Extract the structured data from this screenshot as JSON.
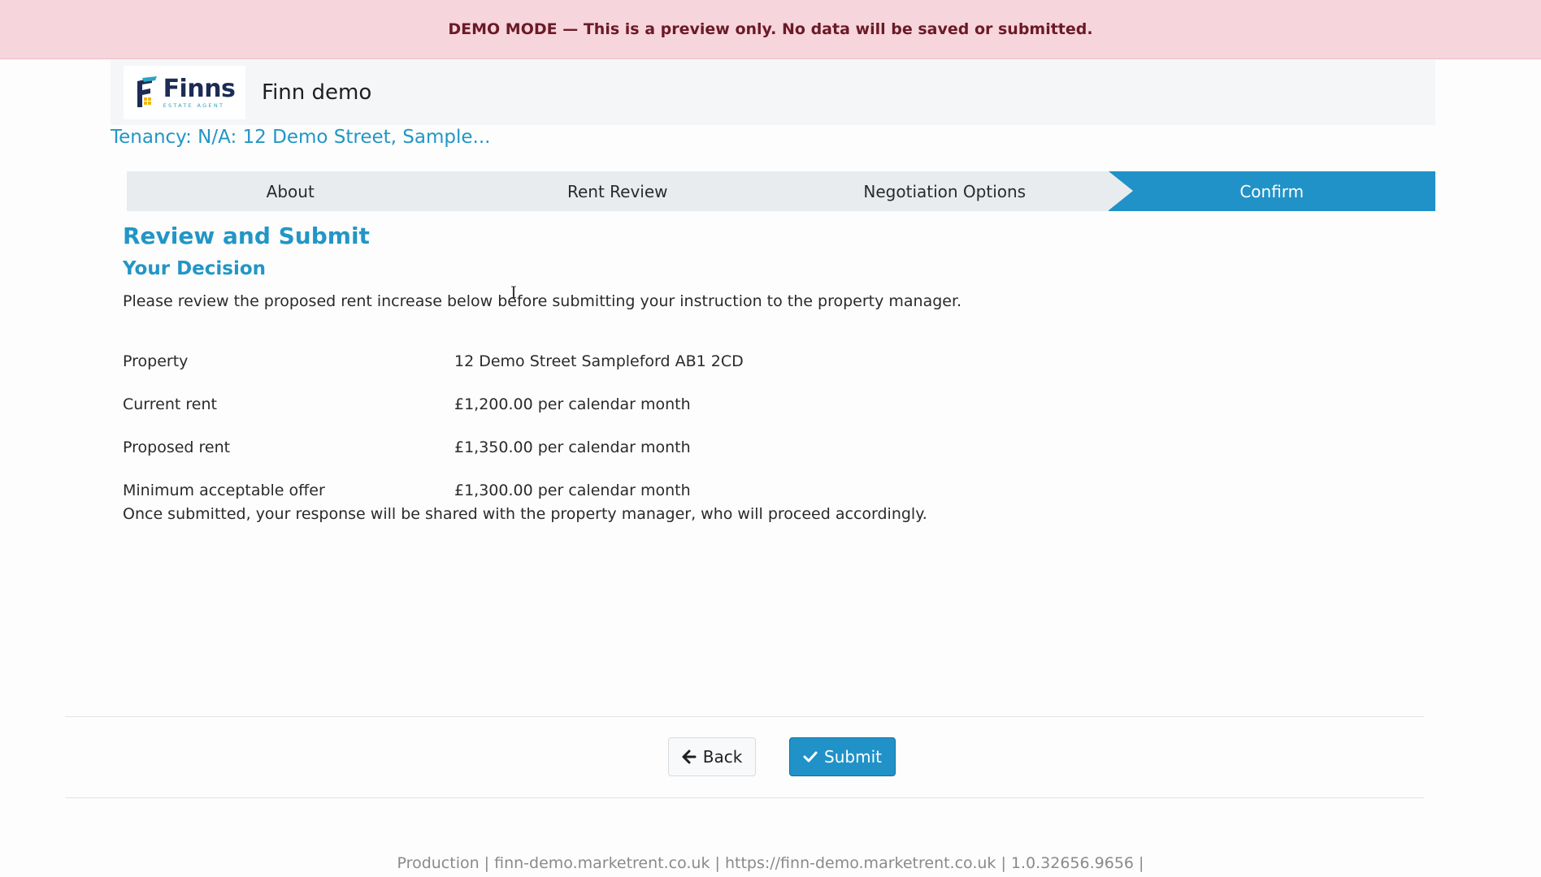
{
  "banner": {
    "text": "DEMO MODE — This is a preview only. No data will be saved or submitted."
  },
  "header": {
    "logo_word": "Finns",
    "logo_sub": "ESTATE AGENT",
    "site_name": "Finn demo"
  },
  "tenancy": {
    "label": "Tenancy: N/A: 12 Demo Street, Sample..."
  },
  "steps": [
    {
      "label": "About"
    },
    {
      "label": "Rent Review"
    },
    {
      "label": "Negotiation Options"
    },
    {
      "label": "Confirm",
      "active": true
    }
  ],
  "main": {
    "title": "Review and Submit",
    "subtitle": "Your Decision",
    "intro": "Please review the proposed rent increase below before submitting your instruction to the property manager.",
    "details": [
      {
        "label": "Property",
        "value": "12 Demo Street Sampleford AB1 2CD"
      },
      {
        "label": "Current rent",
        "value": "£1,200.00 per calendar month"
      },
      {
        "label": "Proposed rent",
        "value": "£1,350.00 per calendar month"
      },
      {
        "label": "Minimum acceptable offer",
        "value": "£1,300.00 per calendar month"
      }
    ],
    "outro": "Once submitted, your response will be shared with the property manager, who will proceed accordingly."
  },
  "actions": {
    "back_label": "Back",
    "submit_label": "Submit",
    "back_icon": "arrow-left-icon",
    "submit_icon": "check-icon"
  },
  "footer": {
    "text": "Production | finn-demo.marketrent.co.uk | https://finn-demo.marketrent.co.uk | 1.0.32656.9656 |"
  },
  "colors": {
    "accent": "#2192c7",
    "banner_bg": "#f7d5dc",
    "banner_text": "#6b1a27",
    "step_bg": "#e9ecef"
  }
}
